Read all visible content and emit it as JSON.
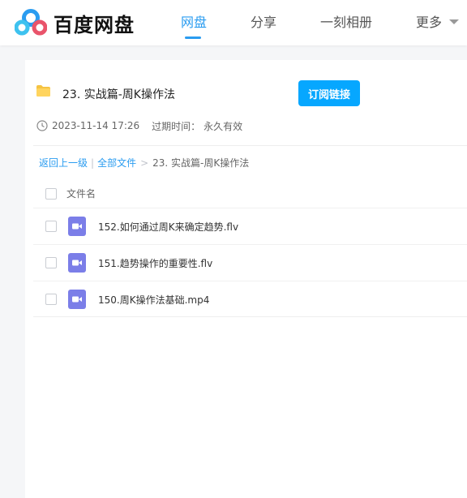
{
  "brand": {
    "name": "百度网盘"
  },
  "nav": {
    "items": [
      {
        "label": "网盘",
        "active": true
      },
      {
        "label": "分享",
        "active": false
      },
      {
        "label": "一刻相册",
        "active": false
      },
      {
        "label": "更多",
        "active": false
      }
    ]
  },
  "share": {
    "title": "23. 实战篇-周K操作法",
    "subscribe_label": "订阅链接",
    "created": "2023-11-14 17:26",
    "expire_label": "过期时间：",
    "expire_value": "永久有效"
  },
  "breadcrumb": {
    "back": "返回上一级",
    "separator": "|",
    "all_files": "全部文件",
    "arrow": ">",
    "current": "23. 实战篇-周K操作法"
  },
  "table": {
    "column_header": "文件名",
    "files": [
      {
        "name": "152.如何通过周K来确定趋势.flv",
        "icon": "video-file-icon"
      },
      {
        "name": "151.趋势操作的重要性.flv",
        "icon": "video-file-icon"
      },
      {
        "name": "150.周K操作法基础.mp4",
        "icon": "video-file-icon"
      }
    ]
  },
  "colors": {
    "accent": "#2a9cf0",
    "button": "#06a7ff",
    "video_icon": "#7b7ee8",
    "folder": "#f5c342"
  }
}
